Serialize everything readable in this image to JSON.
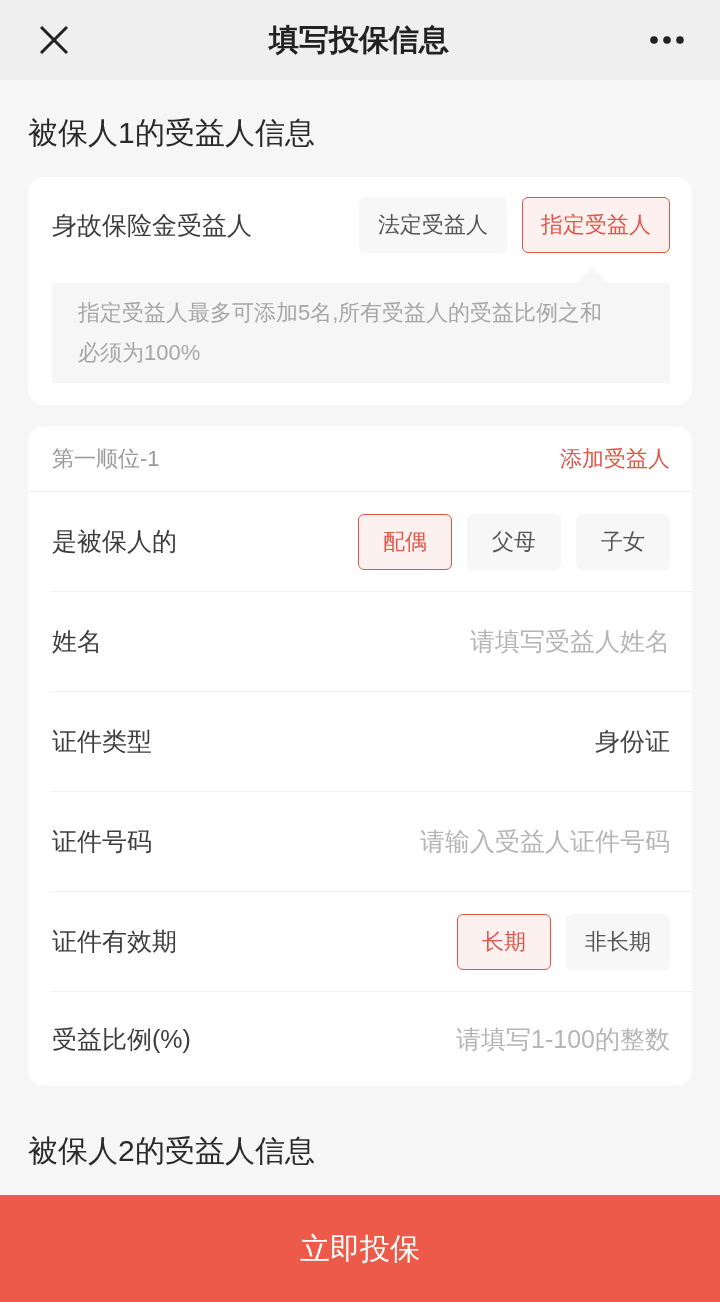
{
  "header": {
    "title": "填写投保信息"
  },
  "sections": [
    {
      "title": "被保人1的受益人信息",
      "type_card": {
        "label": "身故保险金受益人",
        "options": [
          {
            "label": "法定受益人",
            "selected": false
          },
          {
            "label": "指定受益人",
            "selected": true
          }
        ],
        "hint": "指定受益人最多可添加5名,所有受益人的受益比例之和必须为100%"
      },
      "beneficiary": {
        "order": "第一顺位-1",
        "add_link": "添加受益人",
        "fields": [
          {
            "kind": "options",
            "label": "是被保人的",
            "options": [
              {
                "label": "配偶",
                "selected": true
              },
              {
                "label": "父母",
                "selected": false
              },
              {
                "label": "子女",
                "selected": false
              }
            ]
          },
          {
            "kind": "input",
            "label": "姓名",
            "placeholder": "请填写受益人姓名"
          },
          {
            "kind": "value",
            "label": "证件类型",
            "value": "身份证"
          },
          {
            "kind": "input",
            "label": "证件号码",
            "placeholder": "请输入受益人证件号码"
          },
          {
            "kind": "options",
            "label": "证件有效期",
            "options": [
              {
                "label": "长期",
                "selected": true
              },
              {
                "label": "非长期",
                "selected": false
              }
            ]
          },
          {
            "kind": "input",
            "label": "受益比例(%)",
            "placeholder": "请填写1-100的整数"
          }
        ]
      }
    },
    {
      "title": "被保人2的受益人信息"
    }
  ],
  "submit_button": "立即投保"
}
